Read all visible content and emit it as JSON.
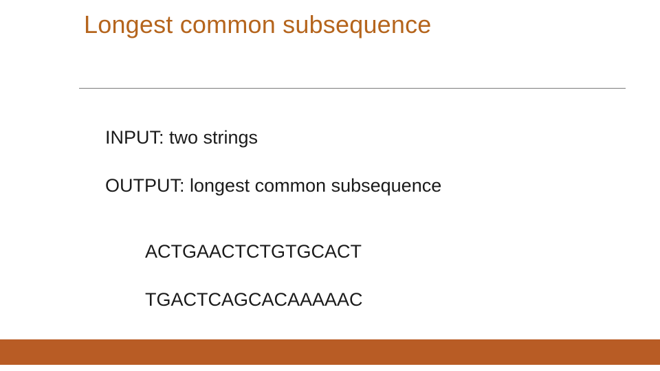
{
  "title": "Longest common subsequence",
  "input_line": "INPUT: two strings",
  "output_line": "OUTPUT: longest common subsequence",
  "sequence_1": "ACTGAACTCTGTGCACT",
  "sequence_2": "TGACTCAGCACAAAAAC"
}
